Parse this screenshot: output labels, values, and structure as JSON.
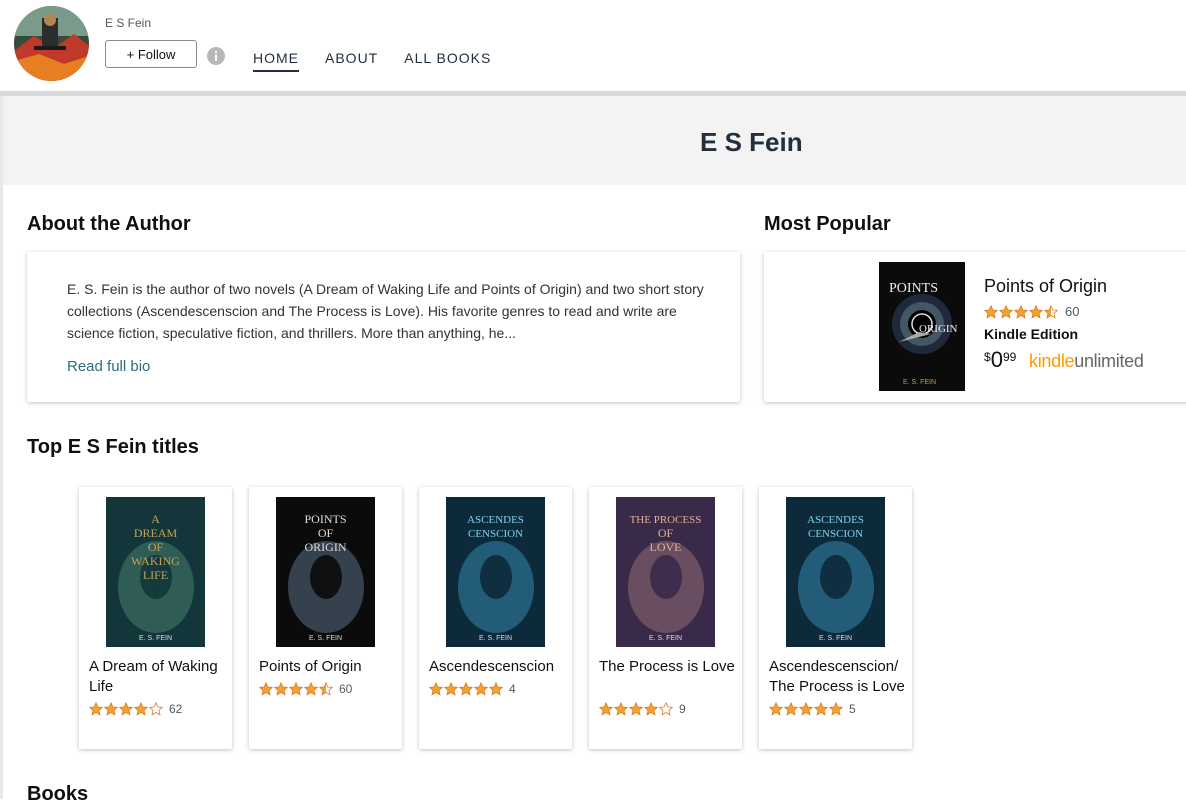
{
  "header": {
    "author_name": "E S Fein",
    "follow_label": "+ Follow",
    "nav": [
      "HOME",
      "ABOUT",
      "ALL BOOKS"
    ],
    "active_nav": "HOME"
  },
  "banner": {
    "title": "E S Fein"
  },
  "about": {
    "title": "About the Author",
    "bio": "E. S. Fein is the author of two novels (A Dream of Waking Life and Points of Origin) and two short story collections (Ascendescenscion and The Process is Love). His favorite genres to read and write are science fiction, speculative fiction, and thrillers. More than anything, he...",
    "read_more": "Read full bio"
  },
  "most_popular": {
    "title": "Most Popular",
    "book_title": "Points of Origin",
    "rating": 4.5,
    "review_count": "60",
    "format": "Kindle Edition",
    "price_symbol": "$",
    "price_whole": "0",
    "price_fraction": "99",
    "ku_kindle": "kindle",
    "ku_unlimited": "unlimited"
  },
  "top_titles": {
    "title": "Top E S Fein titles",
    "books": [
      {
        "title": "A Dream of Waking Life",
        "rating": 4,
        "count": "62",
        "cover_lines": [
          "A",
          "DREAM",
          "OF",
          "WAKING",
          "LIFE"
        ],
        "author": "E. S. FEIN"
      },
      {
        "title": "Points of Origin",
        "rating": 4.5,
        "count": "60",
        "cover_lines": [
          "POINTS",
          "OF",
          "ORIGIN"
        ],
        "author": "E. S. FEIN"
      },
      {
        "title": "Ascendescenscion",
        "rating": 5,
        "count": "4",
        "cover_lines": [
          "ASCENDES",
          "CENSCION"
        ],
        "author": "E. S. FEIN"
      },
      {
        "title": "The Process is Love",
        "rating": 4,
        "count": "9",
        "cover_lines": [
          "THE PROCESS",
          "OF",
          "LOVE"
        ],
        "author": "E. S. FEIN"
      },
      {
        "title": "Ascendescenscion/ The Process is Love",
        "rating": 5,
        "count": "5",
        "cover_lines": [
          "ASCENDES",
          "CENSCION"
        ],
        "author": "E. S. FEIN"
      }
    ]
  },
  "books_section": {
    "title": "Books"
  },
  "colors": {
    "star": "#f0a332",
    "link": "#2e6a82",
    "ku_orange": "#ff9900"
  }
}
